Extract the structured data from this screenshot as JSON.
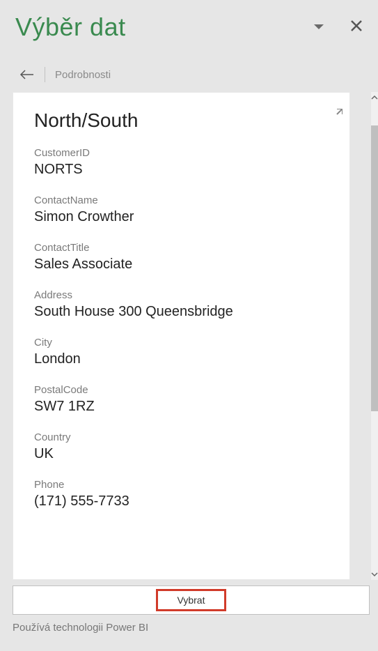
{
  "header": {
    "title": "Výběr dat"
  },
  "breadcrumb": {
    "label": "Podrobnosti"
  },
  "card": {
    "title": "North/South",
    "fields": [
      {
        "label": "CustomerID",
        "value": "NORTS"
      },
      {
        "label": "ContactName",
        "value": "Simon Crowther"
      },
      {
        "label": "ContactTitle",
        "value": "Sales Associate"
      },
      {
        "label": "Address",
        "value": "South House 300 Queensbridge"
      },
      {
        "label": "City",
        "value": "London"
      },
      {
        "label": "PostalCode",
        "value": "SW7 1RZ"
      },
      {
        "label": "Country",
        "value": "UK"
      },
      {
        "label": "Phone",
        "value": "(171) 555-7733"
      }
    ]
  },
  "button": {
    "select_label": "Vybrat"
  },
  "footer": {
    "text": "Používá technologii Power BI"
  }
}
